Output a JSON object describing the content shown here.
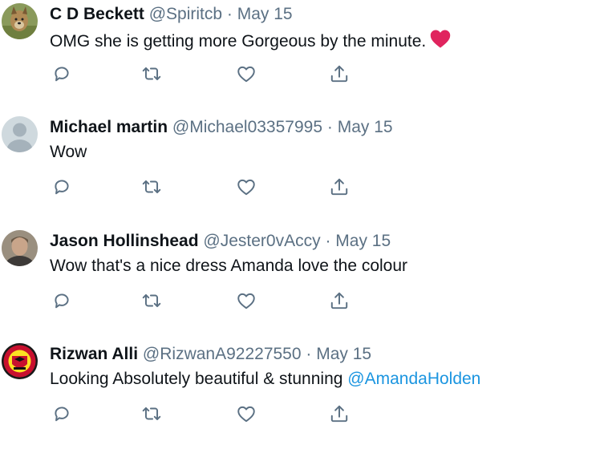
{
  "colors": {
    "text": "#0f1419",
    "muted": "#5b7083",
    "link": "#1b95e0",
    "heart": "#e0245e"
  },
  "tweets": [
    {
      "name": "C D Beckett",
      "handle": "@Spiritcb",
      "separator": "·",
      "date": "May 15",
      "text": "OMG she is getting more Gorgeous by the minute.",
      "emoji": "red-heart-emoji",
      "avatar": "dog-photo-avatar"
    },
    {
      "name": "Michael martin",
      "handle": "@Michael03357995",
      "separator": "·",
      "date": "May 15",
      "text": "Wow",
      "avatar": "default-avatar"
    },
    {
      "name": "Jason Hollinshead",
      "handle": "@Jester0vAccy",
      "separator": "·",
      "date": "May 15",
      "text": "Wow that's a nice dress Amanda love the colour",
      "avatar": "person-photo-avatar"
    },
    {
      "name": "Rizwan Alli",
      "handle": "@RizwanA92227550",
      "separator": "·",
      "date": "May 15",
      "text": "Looking Absolutely beautiful & stunning",
      "mention": "@AmandaHolden",
      "avatar": "football-crest-avatar"
    }
  ],
  "action_icons": [
    "reply-icon",
    "retweet-icon",
    "like-icon",
    "share-icon"
  ]
}
